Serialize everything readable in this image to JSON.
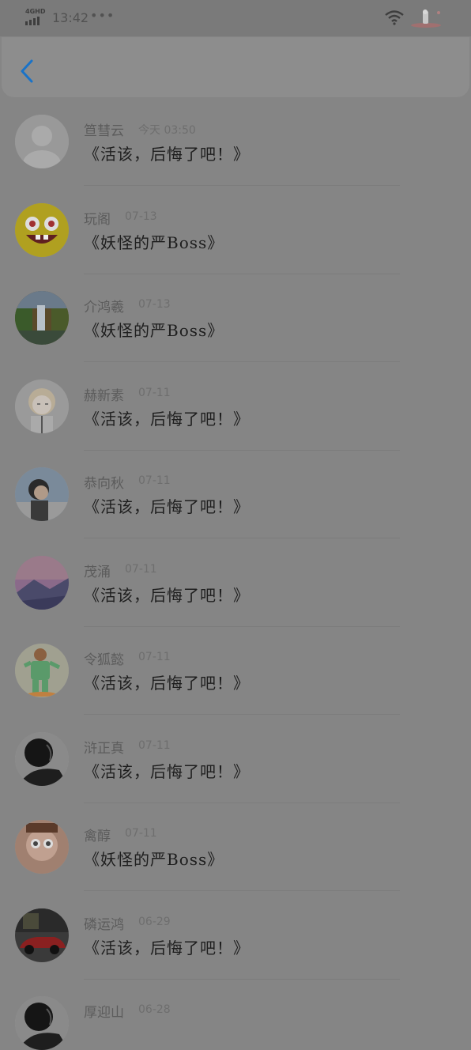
{
  "status_bar": {
    "network": "4GHD",
    "time": "13:42",
    "overflow": "•••",
    "icons": [
      "signal-icon",
      "wifi-icon",
      "battery-icon"
    ]
  },
  "app_bar": {
    "back_icon": "chevron-left-icon",
    "accent_color": "#1a73c8"
  },
  "comments": [
    {
      "name": "笪彗云",
      "time": "今天 03:50",
      "message": "《活该，后悔了吧！》",
      "avatar": "default-avatar"
    },
    {
      "name": "玩阁",
      "time": "07-13",
      "message": "《妖怪的严Boss》",
      "avatar": "sponge-cartoon"
    },
    {
      "name": "介鸿羲",
      "time": "07-13",
      "message": "《妖怪的严Boss》",
      "avatar": "waterfall-landscape"
    },
    {
      "name": "赫新素",
      "time": "07-11",
      "message": "《活该，后悔了吧！》",
      "avatar": "anime-girl"
    },
    {
      "name": "恭向秋",
      "time": "07-11",
      "message": "《活该，后悔了吧！》",
      "avatar": "girl-portrait"
    },
    {
      "name": "茂涌",
      "time": "07-11",
      "message": "《活该，后悔了吧！》",
      "avatar": "sunset-mountains"
    },
    {
      "name": "令狐懿",
      "time": "07-11",
      "message": "《活该，后悔了吧！》",
      "avatar": "cartoon-figure"
    },
    {
      "name": "浒正真",
      "time": "07-11",
      "message": "《活该，后悔了吧！》",
      "avatar": "dark-figure"
    },
    {
      "name": "禽醇",
      "time": "07-11",
      "message": "《妖怪的严Boss》",
      "avatar": "child-photo"
    },
    {
      "name": "磷运鸿",
      "time": "06-29",
      "message": "《活该，后悔了吧！》",
      "avatar": "red-car"
    },
    {
      "name": "厚迎山",
      "time": "06-28",
      "message": "",
      "avatar": "dark-figure"
    }
  ]
}
